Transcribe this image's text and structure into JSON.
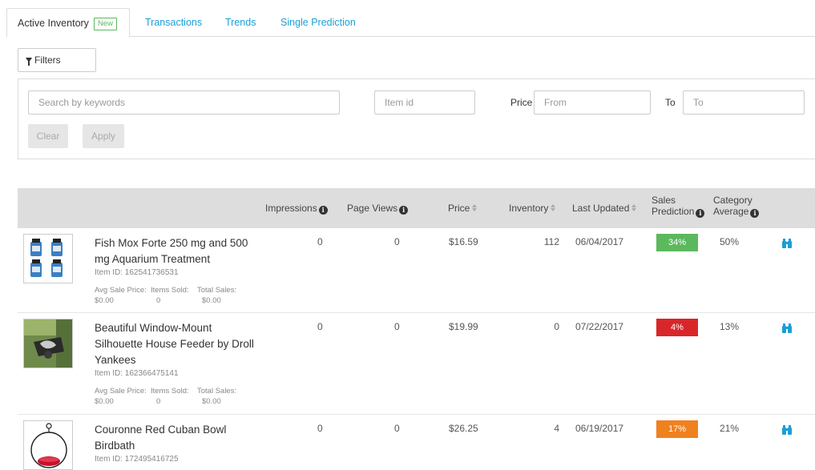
{
  "tabs": [
    {
      "label": "Active Inventory",
      "badge": "New"
    },
    {
      "label": "Transactions"
    },
    {
      "label": "Trends"
    },
    {
      "label": "Single Prediction"
    }
  ],
  "filters": {
    "toggle_label": "Filters",
    "keywords_placeholder": "Search by keywords",
    "itemid_placeholder": "Item id",
    "price_label": "Price",
    "from_placeholder": "From",
    "to_label": "To",
    "to_placeholder": "To",
    "clear_label": "Clear",
    "apply_label": "Apply"
  },
  "table": {
    "headers": {
      "impressions": "Impressions",
      "page_views": "Page Views",
      "price": "Price",
      "inventory": "Inventory",
      "last_updated": "Last Updated",
      "sales_prediction_1": "Sales",
      "sales_prediction_2": "Prediction",
      "category_average_1": "Category",
      "category_average_2": "Average"
    },
    "rows": [
      {
        "title": "Fish Mox Forte 250 mg and 500 mg Aquarium Treatment",
        "item_id": "Item ID: 162541736531",
        "avg_sale_label": "Avg Sale Price:",
        "avg_sale_value": "$0.00",
        "items_sold_label": "Items Sold:",
        "items_sold_value": "0",
        "total_sales_label": "Total Sales:",
        "total_sales_value": "$0.00",
        "impressions": "0",
        "page_views": "0",
        "price": "$16.59",
        "inventory": "112",
        "last_updated": "06/04/2017",
        "prediction": "34%",
        "prediction_color": "#5cb85c",
        "category_average": "50%"
      },
      {
        "title": "Beautiful Window-Mount Silhouette House Feeder by Droll Yankees",
        "item_id": "Item ID: 162366475141",
        "avg_sale_label": "Avg Sale Price:",
        "avg_sale_value": "$0.00",
        "items_sold_label": "Items Sold:",
        "items_sold_value": "0",
        "total_sales_label": "Total Sales:",
        "total_sales_value": "$0.00",
        "impressions": "0",
        "page_views": "0",
        "price": "$19.99",
        "inventory": "0",
        "last_updated": "07/22/2017",
        "prediction": "4%",
        "prediction_color": "#d9262a",
        "category_average": "13%"
      },
      {
        "title": "Couronne Red Cuban Bowl Birdbath",
        "item_id": "Item ID: 172495416725",
        "impressions": "0",
        "page_views": "0",
        "price": "$26.25",
        "inventory": "4",
        "last_updated": "06/19/2017",
        "prediction": "17%",
        "prediction_color": "#f0811f",
        "category_average": "21%"
      }
    ]
  },
  "colors": {
    "accent": "#1a9fd6",
    "header_bg": "#dddddd"
  },
  "icons": {
    "filter": "filter-icon",
    "info": "info-icon",
    "sort": "sort-icon",
    "details": "binoculars-icon"
  }
}
